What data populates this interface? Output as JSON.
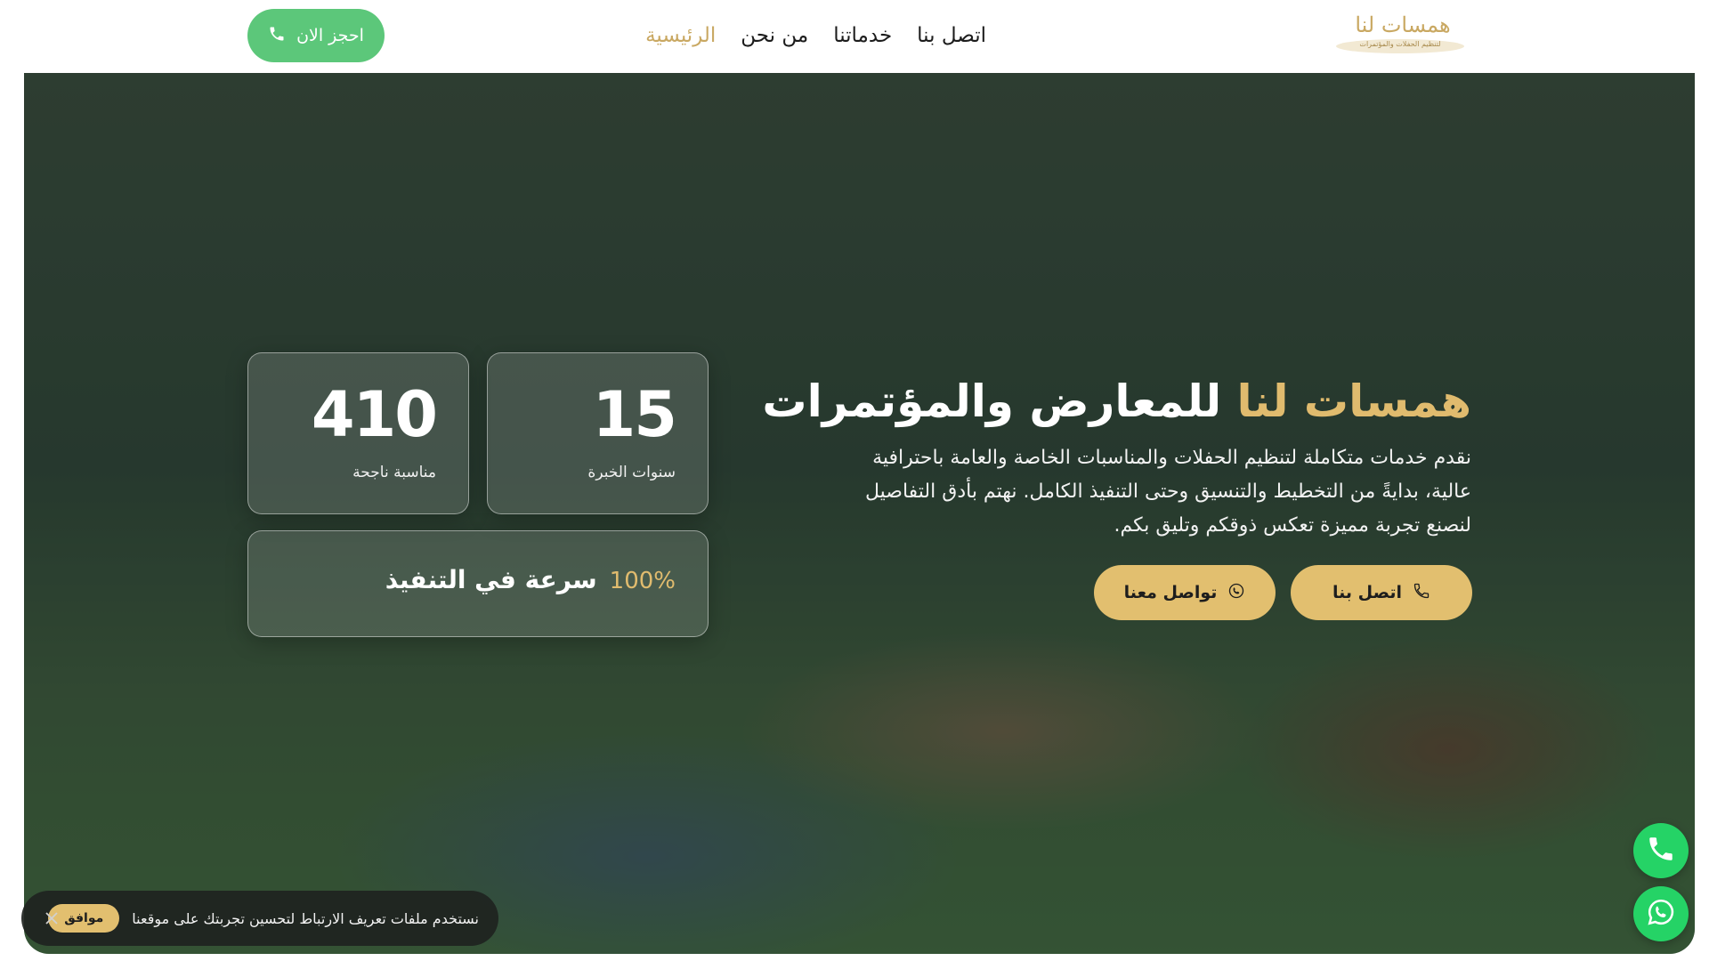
{
  "header": {
    "book_button": "احجز الان",
    "nav": [
      {
        "label": "الرئيسية",
        "active": true
      },
      {
        "label": "من نحن",
        "active": false
      },
      {
        "label": "خدماتنا",
        "active": false
      },
      {
        "label": "اتصل بنا",
        "active": false
      }
    ],
    "logo_text": "همسات لنا",
    "logo_subtext": "لتنظيم الحفلات والمؤتمرات"
  },
  "hero": {
    "title_accent": "همسات لنا",
    "title_rest": "للمعارض والمؤتمرات",
    "description": "نقدم خدمات متكاملة لتنظيم الحفلات والمناسبات الخاصة والعامة باحترافية عالية، بدايةً من التخطيط والتنسيق وحتى التنفيذ الكامل. نهتم بأدق التفاصيل لنصنع تجربة مميزة تعكس ذوقكم وتليق بكم.",
    "cta_call": "اتصل بنا",
    "cta_whatsapp": "تواصل معنا"
  },
  "stats": {
    "years_value": "15",
    "years_label": "سنوات الخبرة",
    "events_value": "410",
    "events_label": "مناسبة ناجحة",
    "speed_value": "100%",
    "speed_label": "سرعة في التنفيذ"
  },
  "cookie": {
    "text": "نستخدم ملفات تعريف الارتباط لتحسين تجربتك على موقعنا",
    "accept": "موافق"
  },
  "colors": {
    "accent_gold": "#e0bb6e",
    "book_green": "#5cc77a",
    "whatsapp_green": "#25d366"
  },
  "icons": [
    "phone-icon",
    "whatsapp-icon",
    "close-icon"
  ]
}
